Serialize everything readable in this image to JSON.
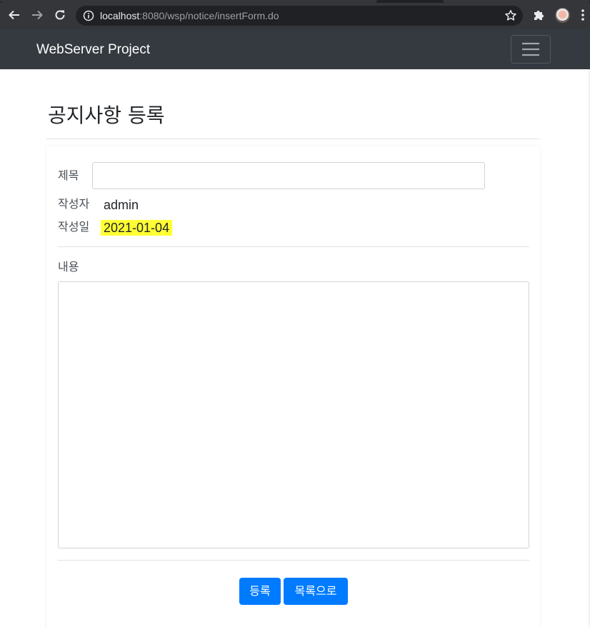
{
  "browser": {
    "url_host": "localhost",
    "url_path": ":8080/wsp/notice/insertForm.do",
    "icons": {
      "back": "back-arrow-icon",
      "forward": "forward-arrow-icon",
      "reload": "reload-icon",
      "site_info": "info-icon",
      "bookmark": "star-icon",
      "extensions": "puzzle-icon",
      "menu": "vertical-dots-icon"
    }
  },
  "navbar": {
    "brand": "WebServer Project",
    "toggler_icon": "hamburger-icon",
    "background": "#343a40"
  },
  "page": {
    "title": "공지사항 등록"
  },
  "form": {
    "title_label": "제목",
    "title_value": "",
    "writer_label": "작성자",
    "writer_value": "admin",
    "date_label": "작성일",
    "date_value": "2021-01-04",
    "date_highlight": "#ffff33",
    "content_label": "내용",
    "content_value": ""
  },
  "buttons": {
    "submit": "등록",
    "list": "목록으로",
    "color": "#007bff"
  }
}
